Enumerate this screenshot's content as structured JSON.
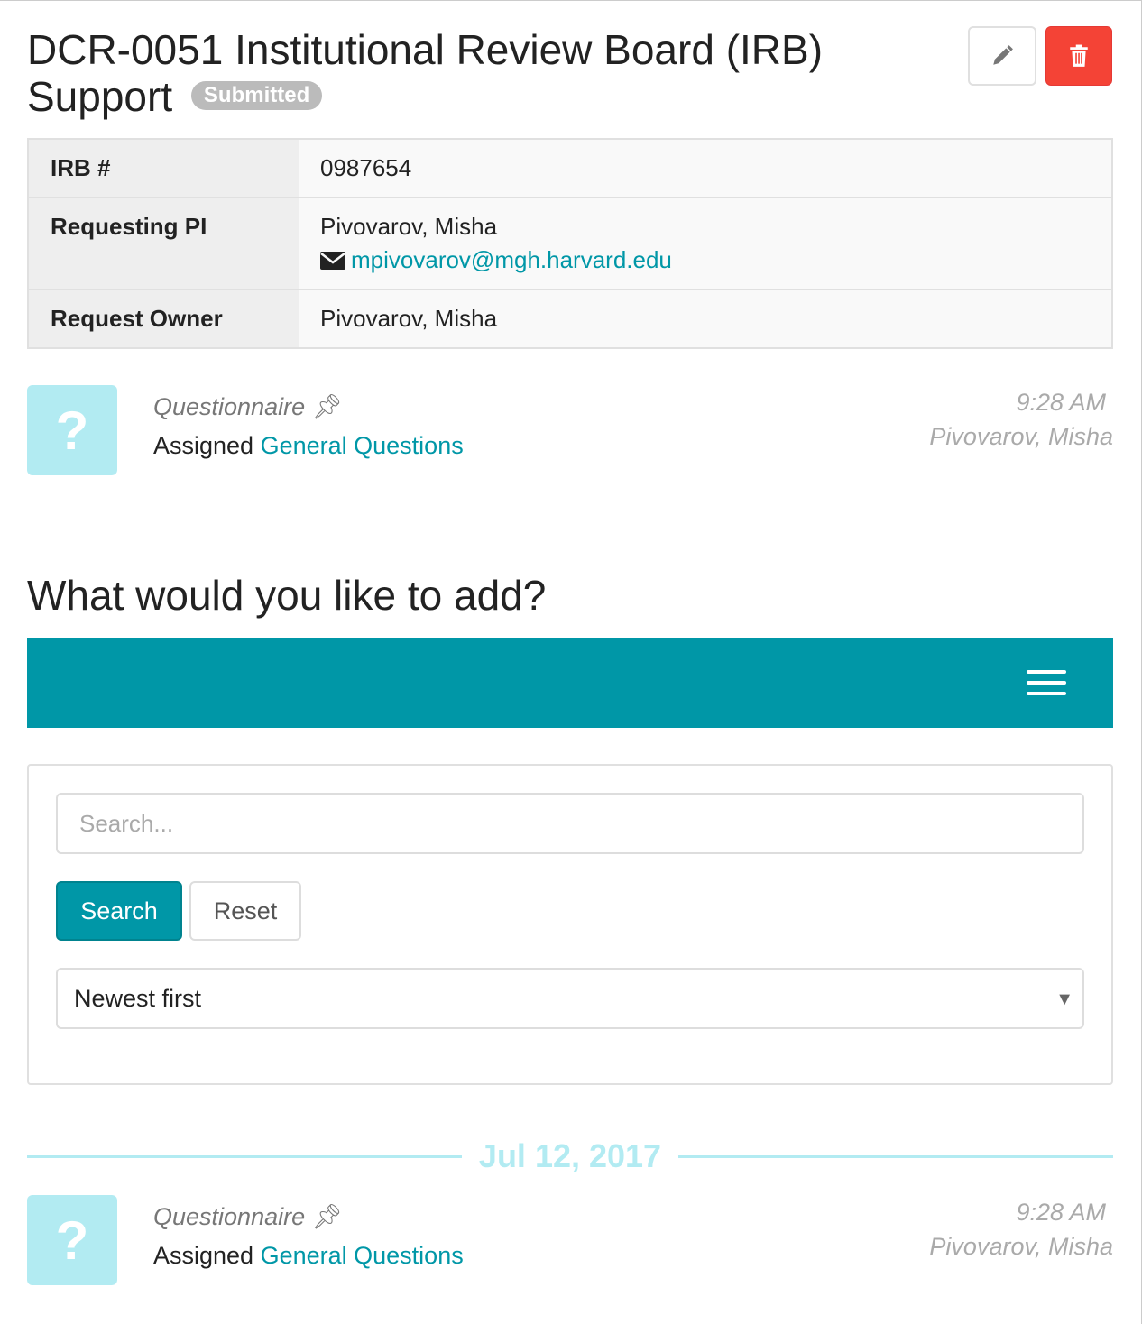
{
  "header": {
    "title": "DCR-0051 Institutional Review Board (IRB) Support",
    "status": "Submitted",
    "edit_icon": "pencil-icon",
    "delete_icon": "trash-icon"
  },
  "details": [
    {
      "label": "IRB #",
      "value": "0987654"
    },
    {
      "label": "Requesting PI",
      "value": "Pivovarov, Misha",
      "email": "mpivovarov@mgh.harvard.edu"
    },
    {
      "label": "Request Owner",
      "value": "Pivovarov, Misha"
    }
  ],
  "events": [
    {
      "type": "Questionnaire",
      "text": "Assigned",
      "link": "General Questions",
      "time": "9:28 AM",
      "user": "Pivovarov, Misha"
    },
    {
      "type": "Questionnaire",
      "text": "Assigned",
      "link": "General Questions",
      "time": "9:28 AM",
      "user": "Pivovarov, Misha"
    }
  ],
  "add": {
    "heading": "What would you like to add?"
  },
  "filter": {
    "search_placeholder": "Search...",
    "search_label": "Search",
    "reset_label": "Reset",
    "sort_selected": "Newest first"
  },
  "date_divider": "Jul 12, 2017",
  "colors": {
    "accent": "#0097a7",
    "danger": "#f44336",
    "light_accent": "#b2ebf2"
  }
}
